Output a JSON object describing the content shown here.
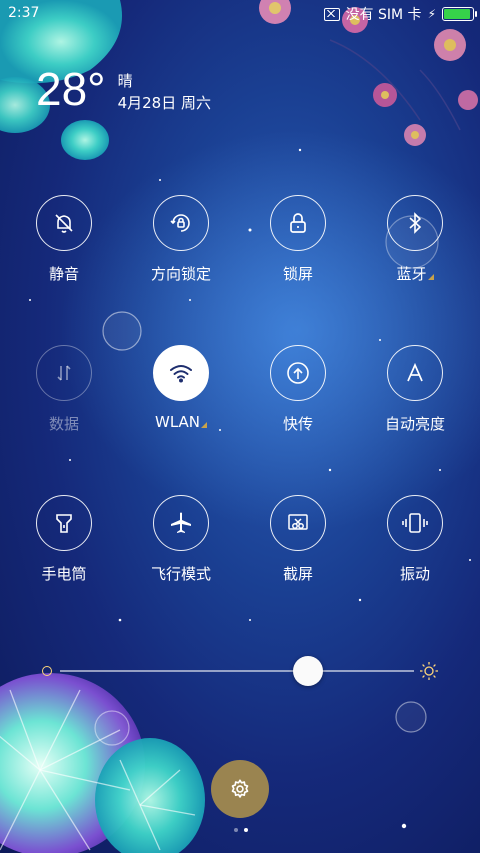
{
  "status_bar": {
    "time": "2:37",
    "sim_text": "没有 SIM 卡",
    "battery_level": 1.0,
    "battery_color": "#36d24a"
  },
  "weather": {
    "temperature": "28°",
    "condition": "晴",
    "date": "4月28日 周六"
  },
  "toggles": [
    {
      "label": "静音",
      "icon": "bell-off-icon",
      "state": "off"
    },
    {
      "label": "方向锁定",
      "icon": "rotation-lock-icon",
      "state": "off"
    },
    {
      "label": "锁屏",
      "icon": "lock-icon",
      "state": "off"
    },
    {
      "label": "蓝牙",
      "icon": "bluetooth-icon",
      "state": "off",
      "has_more": true
    },
    {
      "label": "数据",
      "icon": "data-arrows-icon",
      "state": "disabled"
    },
    {
      "label": "WLAN",
      "icon": "wifi-icon",
      "state": "on",
      "has_more": true
    },
    {
      "label": "快传",
      "icon": "quick-transfer-icon",
      "state": "off"
    },
    {
      "label": "自动亮度",
      "icon": "auto-brightness-icon",
      "state": "off"
    },
    {
      "label": "手电筒",
      "icon": "flashlight-icon",
      "state": "off"
    },
    {
      "label": "飞行模式",
      "icon": "airplane-icon",
      "state": "off"
    },
    {
      "label": "截屏",
      "icon": "screenshot-icon",
      "state": "off"
    },
    {
      "label": "振动",
      "icon": "vibrate-icon",
      "state": "off"
    }
  ],
  "brightness": {
    "level": 0.7
  },
  "settings": {
    "icon": "gear-icon",
    "color": "#9a8450"
  },
  "pager": {
    "pages": 2,
    "current": 1
  },
  "colors": {
    "accent_gold": "#c8a24a",
    "bg_dark": "#15297a"
  }
}
